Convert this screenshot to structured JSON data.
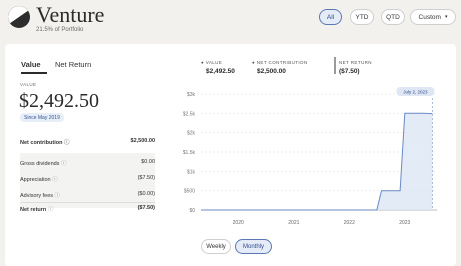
{
  "header": {
    "title": "Venture",
    "subtitle": "21.5% of Portfolio",
    "ranges": [
      "All",
      "YTD",
      "QTD",
      "Custom"
    ],
    "active_range": "All"
  },
  "tabs": [
    "Value",
    "Net Return"
  ],
  "active_tab": "Value",
  "summary": {
    "label": "VALUE",
    "value": "$2,492.50",
    "since": "Since May 2019",
    "net_contribution_label": "Net contribution",
    "net_contribution_value": "$2,500.00",
    "rows": [
      {
        "label": "Gross dividends",
        "value": "$0.00"
      },
      {
        "label": "Appreciation",
        "value": "($7.50)"
      },
      {
        "label": "Advisory fees",
        "value": "($0.00)"
      }
    ],
    "net_return_label": "Net return",
    "net_return_value": "($7.50)"
  },
  "legend": [
    {
      "name": "VALUE",
      "value": "$2,492.50"
    },
    {
      "name": "NET CONTRIBUTION",
      "value": "$2,500.00"
    },
    {
      "name": "NET RETURN",
      "value": "($7.50)"
    }
  ],
  "chart_data": {
    "type": "area",
    "y_ticks": [
      "$3k",
      "$2.5k",
      "$2k",
      "$1.5k",
      "$1k",
      "$500",
      "$0"
    ],
    "x_ticks": [
      "2020",
      "2021",
      "2022",
      "2023"
    ],
    "ylim": [
      0,
      3000
    ],
    "xlim": [
      "2019-05-01",
      "2023-08-01"
    ],
    "tooltip": "July 2, 2023",
    "series": [
      {
        "x": [
          "2019-05-01",
          "2022-07-01",
          "2022-08-01",
          "2022-12-01",
          "2023-01-01",
          "2023-04-01",
          "2023-05-01",
          "2023-07-02"
        ],
        "values": [
          0,
          0,
          500,
          500,
          2500,
          2500,
          2500,
          2492.5
        ]
      }
    ],
    "grid": true,
    "legend": "top"
  },
  "frequency": [
    "Weekly",
    "Monthly"
  ],
  "active_frequency": "Monthly",
  "colors": {
    "line": "#6a8bc4",
    "fill": "#dce6f4",
    "accent": "#2b4a88"
  }
}
